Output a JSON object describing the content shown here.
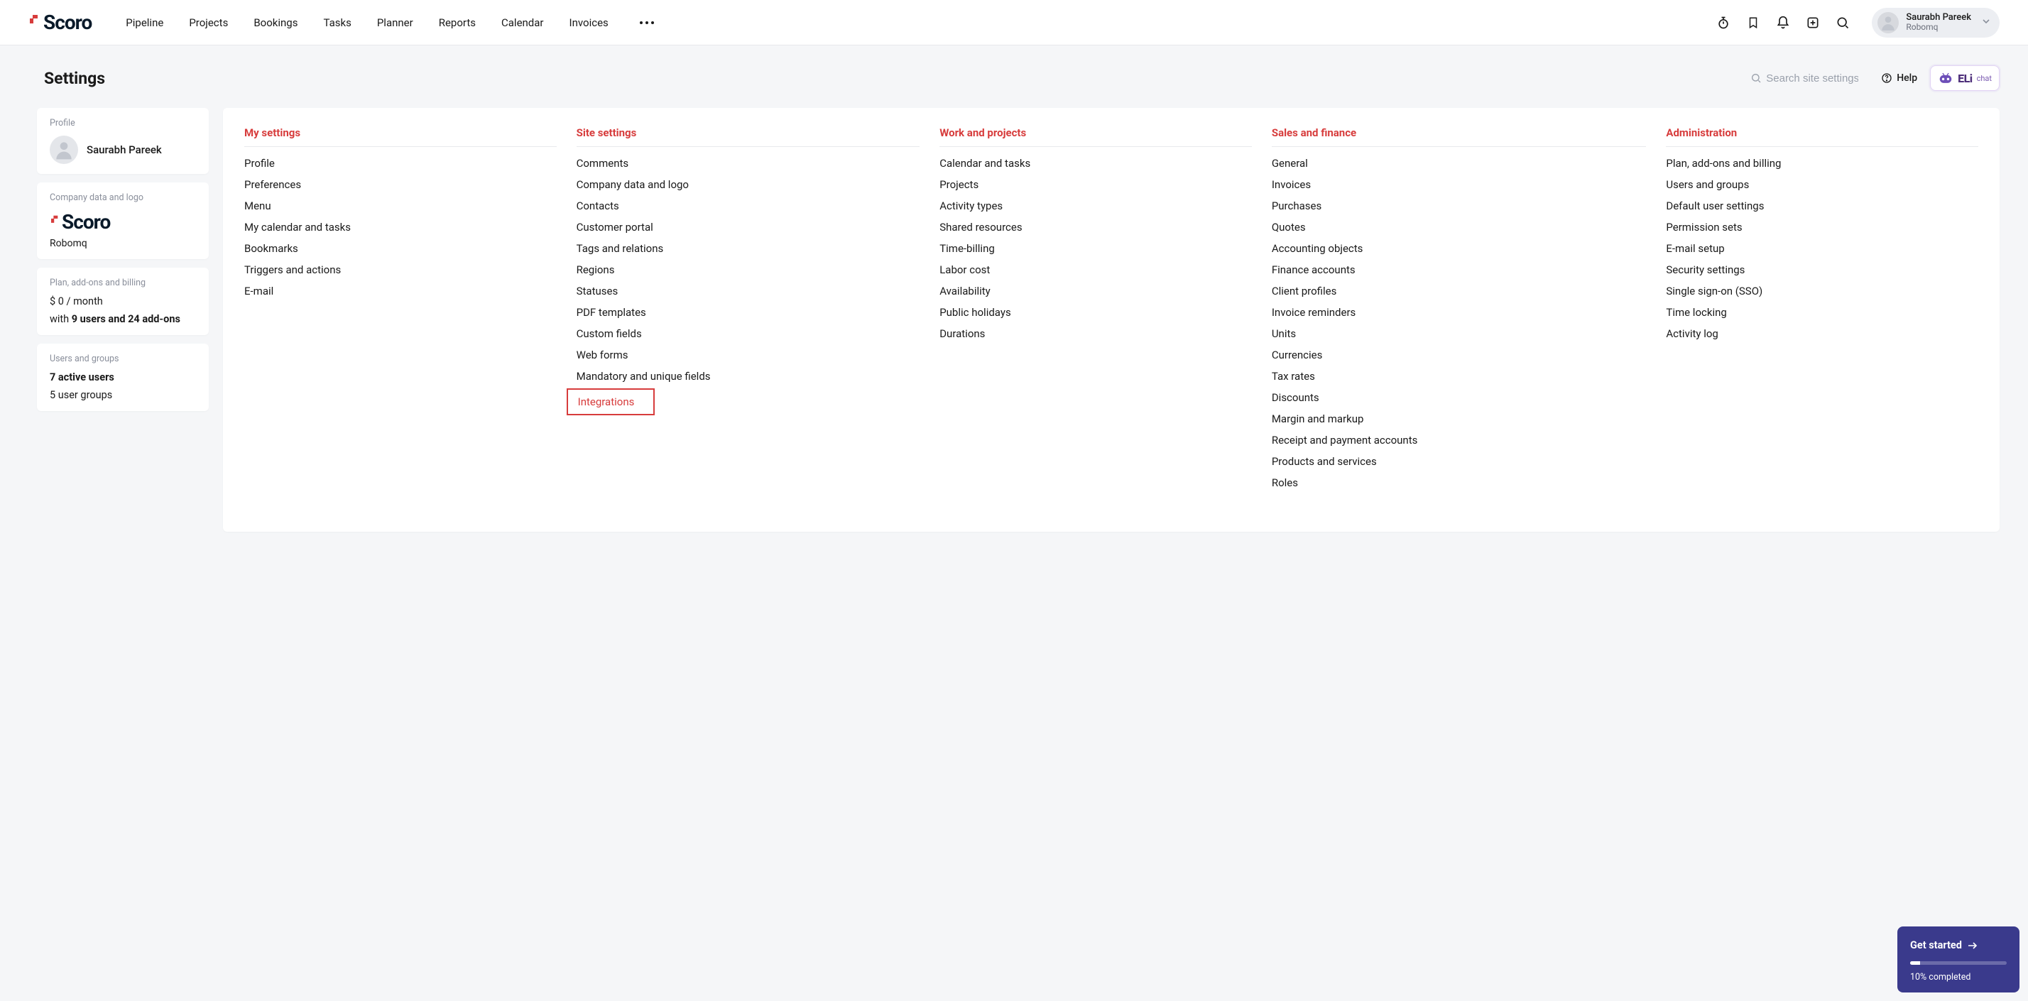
{
  "brand": "Scoro",
  "nav": [
    "Pipeline",
    "Projects",
    "Bookings",
    "Tasks",
    "Planner",
    "Reports",
    "Calendar",
    "Invoices"
  ],
  "user": {
    "name": "Saurabh Pareek",
    "org": "Robomq"
  },
  "page": {
    "title": "Settings",
    "search_placeholder": "Search site settings",
    "help_label": "Help",
    "eli_text": "ELi",
    "eli_chat": "chat"
  },
  "sidebar": {
    "profile": {
      "label": "Profile",
      "name": "Saurabh Pareek"
    },
    "company": {
      "label": "Company data and logo",
      "logo_text": "Scoro",
      "name": "Robomq"
    },
    "plan": {
      "label": "Plan, add-ons and billing",
      "price": "$ 0 / month",
      "with": "with ",
      "addons": "9 users and 24 add-ons"
    },
    "users": {
      "label": "Users and groups",
      "active": "7 active users",
      "groups": "5 user groups"
    }
  },
  "columns": [
    {
      "heading": "My settings",
      "items": [
        "Profile",
        "Preferences",
        "Menu",
        "My calendar and tasks",
        "Bookmarks",
        "Triggers and actions",
        "E-mail"
      ]
    },
    {
      "heading": "Site settings",
      "items": [
        "Comments",
        "Company data and logo",
        "Contacts",
        "Customer portal",
        "Tags and relations",
        "Regions",
        "Statuses",
        "PDF templates",
        "Custom fields",
        "Web forms",
        "Mandatory and unique fields",
        "Integrations"
      ],
      "highlight_index": 11
    },
    {
      "heading": "Work and projects",
      "items": [
        "Calendar and tasks",
        "Projects",
        "Activity types",
        "Shared resources",
        "Time-billing",
        "Labor cost",
        "Availability",
        "Public holidays",
        "Durations"
      ]
    },
    {
      "heading": "Sales and finance",
      "items": [
        "General",
        "Invoices",
        "Purchases",
        "Quotes",
        "Accounting objects",
        "Finance accounts",
        "Client profiles",
        "Invoice reminders",
        "Units",
        "Currencies",
        "Tax rates",
        "Discounts",
        "Margin and markup",
        "Receipt and payment accounts",
        "Products and services",
        "Roles"
      ]
    },
    {
      "heading": "Administration",
      "items": [
        "Plan, add-ons and billing",
        "Users and groups",
        "Default user settings",
        "Permission sets",
        "E-mail setup",
        "Security settings",
        "Single sign-on (SSO)",
        "Time locking",
        "Activity log"
      ]
    }
  ],
  "get_started": {
    "title": "Get started",
    "percent": 10,
    "text": "10% completed"
  }
}
